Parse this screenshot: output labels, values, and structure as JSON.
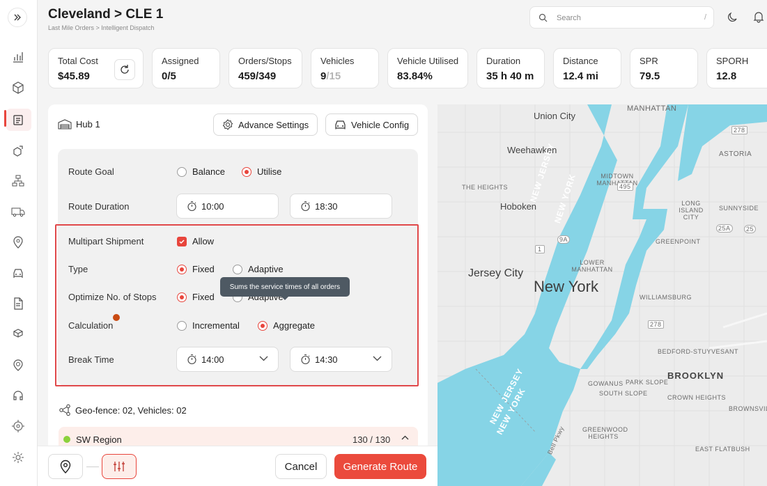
{
  "header": {
    "title": "Cleveland > CLE 1",
    "breadcrumb": "Last Mile Orders > Intelligent Dispatch",
    "search_placeholder": "Search",
    "search_shortcut": "/"
  },
  "metrics": [
    {
      "label": "Total Cost",
      "value": "$45.89"
    },
    {
      "label": "Assigned",
      "value": "0/5"
    },
    {
      "label": "Orders/Stops",
      "value": "459/349"
    },
    {
      "label": "Vehicles",
      "value": "9",
      "value_muted": "/15"
    },
    {
      "label": "Vehicle Utilised",
      "value": "83.84%"
    },
    {
      "label": "Duration",
      "value": "35 h 40 m"
    },
    {
      "label": "Distance",
      "value": "12.4 mi"
    },
    {
      "label": "SPR",
      "value": "79.5"
    },
    {
      "label": "SPORH",
      "value": "12.8"
    }
  ],
  "panel": {
    "hub_name": "Hub 1",
    "advance_settings": "Advance Settings",
    "vehicle_config": "Vehicle Config",
    "route_goal": {
      "label": "Route Goal",
      "options": [
        "Balance",
        "Utilise"
      ],
      "selected": "Utilise"
    },
    "route_duration": {
      "label": "Route Duration",
      "start": "10:00",
      "end": "18:30"
    },
    "multipart": {
      "label": "Multipart Shipment",
      "checkbox_label": "Allow",
      "checked": true
    },
    "type": {
      "label": "Type",
      "options": [
        "Fixed",
        "Adaptive"
      ],
      "selected": "Fixed"
    },
    "optimize_stops": {
      "label": "Optimize No. of Stops",
      "options": [
        "Fixed",
        "Adaptive"
      ],
      "selected": "Fixed"
    },
    "tooltip": "Sums the service times of all orders",
    "calculation": {
      "label": "Calculation",
      "options": [
        "Incremental",
        "Aggregate"
      ],
      "selected": "Aggregate"
    },
    "break_time": {
      "label": "Break Time",
      "start": "14:00",
      "end": "14:30"
    },
    "geofence": "Geo-fence: 02, Vehicles: 02",
    "region": {
      "name": "SW Region",
      "count": "130 / 130"
    }
  },
  "footer": {
    "cancel": "Cancel",
    "generate": "Generate Route"
  },
  "map": {
    "labels": {
      "union_city": "Union City",
      "manhattan": "MANHATTAN",
      "weehawken": "Weehawken",
      "astoria": "ASTORIA",
      "midtown": "MIDTOWN MANHATTAN",
      "the_heights": "THE HEIGHTS",
      "hoboken": "Hoboken",
      "long_island_city": "LONG ISLAND CITY",
      "sunnyside": "SUNNYSIDE",
      "greenpoint": "GREENPOINT",
      "jersey_city": "Jersey City",
      "new_york": "New York",
      "lower_manhattan": "LOWER MANHATTAN",
      "williamsburg": "WILLIAMSBURG",
      "bedford_stuyvesant": "BEDFORD-STUYVESANT",
      "brooklyn": "BROOKLYN",
      "crown_heights": "CROWN HEIGHTS",
      "brownsville": "BROWNSVILLE",
      "gowanus": "GOWANUS",
      "park_slope": "PARK SLOPE",
      "south_slope": "SOUTH SLOPE",
      "greenwood_heights": "GREENWOOD HEIGHTS",
      "east_flatbush": "EAST FLATBUSH",
      "new_jersey_1": "NEW JERSEY",
      "new_york_1": "NEW YORK",
      "new_jersey_2": "NEW JERSEY",
      "new_york_2": "NEW YORK",
      "bell_pkwy": "Bell Pkwy",
      "hwy_495": "495",
      "hwy_278a": "278",
      "hwy_278b": "278",
      "hwy_9a": "9A",
      "hwy_1": "1",
      "hwy_25": "25",
      "hwy_25a": "25A"
    },
    "colors": {
      "water": "#86d4e6",
      "land": "#ececec"
    }
  },
  "colors": {
    "accent": "#e8453c"
  }
}
